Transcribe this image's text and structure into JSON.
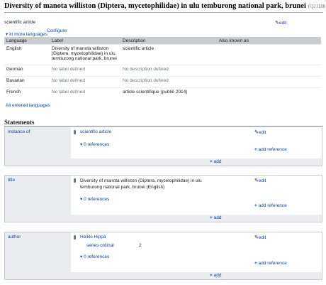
{
  "header": {
    "title": "Diversity of manota williston (Diptera, mycetophilidae) in ulu temburong national park, brunei",
    "qid": "(Q21188431)"
  },
  "description": "scientific article",
  "edit_label": "edit",
  "in_more_languages": "In more languages",
  "configure": "Configure",
  "terms": {
    "columns": [
      "Language",
      "Label",
      "Description",
      "Also known as"
    ],
    "rows": [
      {
        "lang": "English",
        "label": "Diversity of manota williston (Diptera, mycetophilidae) in ulu temburong national park, brunei",
        "desc": "scientific article",
        "aka": ""
      },
      {
        "lang": "German",
        "label": "No label defined",
        "desc": "No description defined",
        "aka": ""
      },
      {
        "lang": "Bavarian",
        "label": "No label defined",
        "desc": "No description defined",
        "aka": ""
      },
      {
        "lang": "French",
        "label": "No label defined",
        "desc": "article scientifique (publié 2014)",
        "aka": ""
      }
    ]
  },
  "all_languages": "All entered languages",
  "statements_title": "Statements",
  "statements": [
    {
      "prop": "instance of",
      "value": "scientific article",
      "refs": "0 references"
    },
    {
      "prop": "title",
      "value": "Diversity of manota williston (Diptera, mycetophilidae) in ulu temburong national park, brunei (English)",
      "refs": "0 references"
    },
    {
      "prop": "author",
      "value": "Heikki Hippa",
      "qualifier_prop": "series ordinal",
      "qualifier_value": "2",
      "refs": "0 references"
    }
  ],
  "add_reference": "add reference",
  "add": "add",
  "icons": [
    "pencil-icon",
    "rank-icon",
    "plus-icon",
    "chevron-down-icon"
  ]
}
